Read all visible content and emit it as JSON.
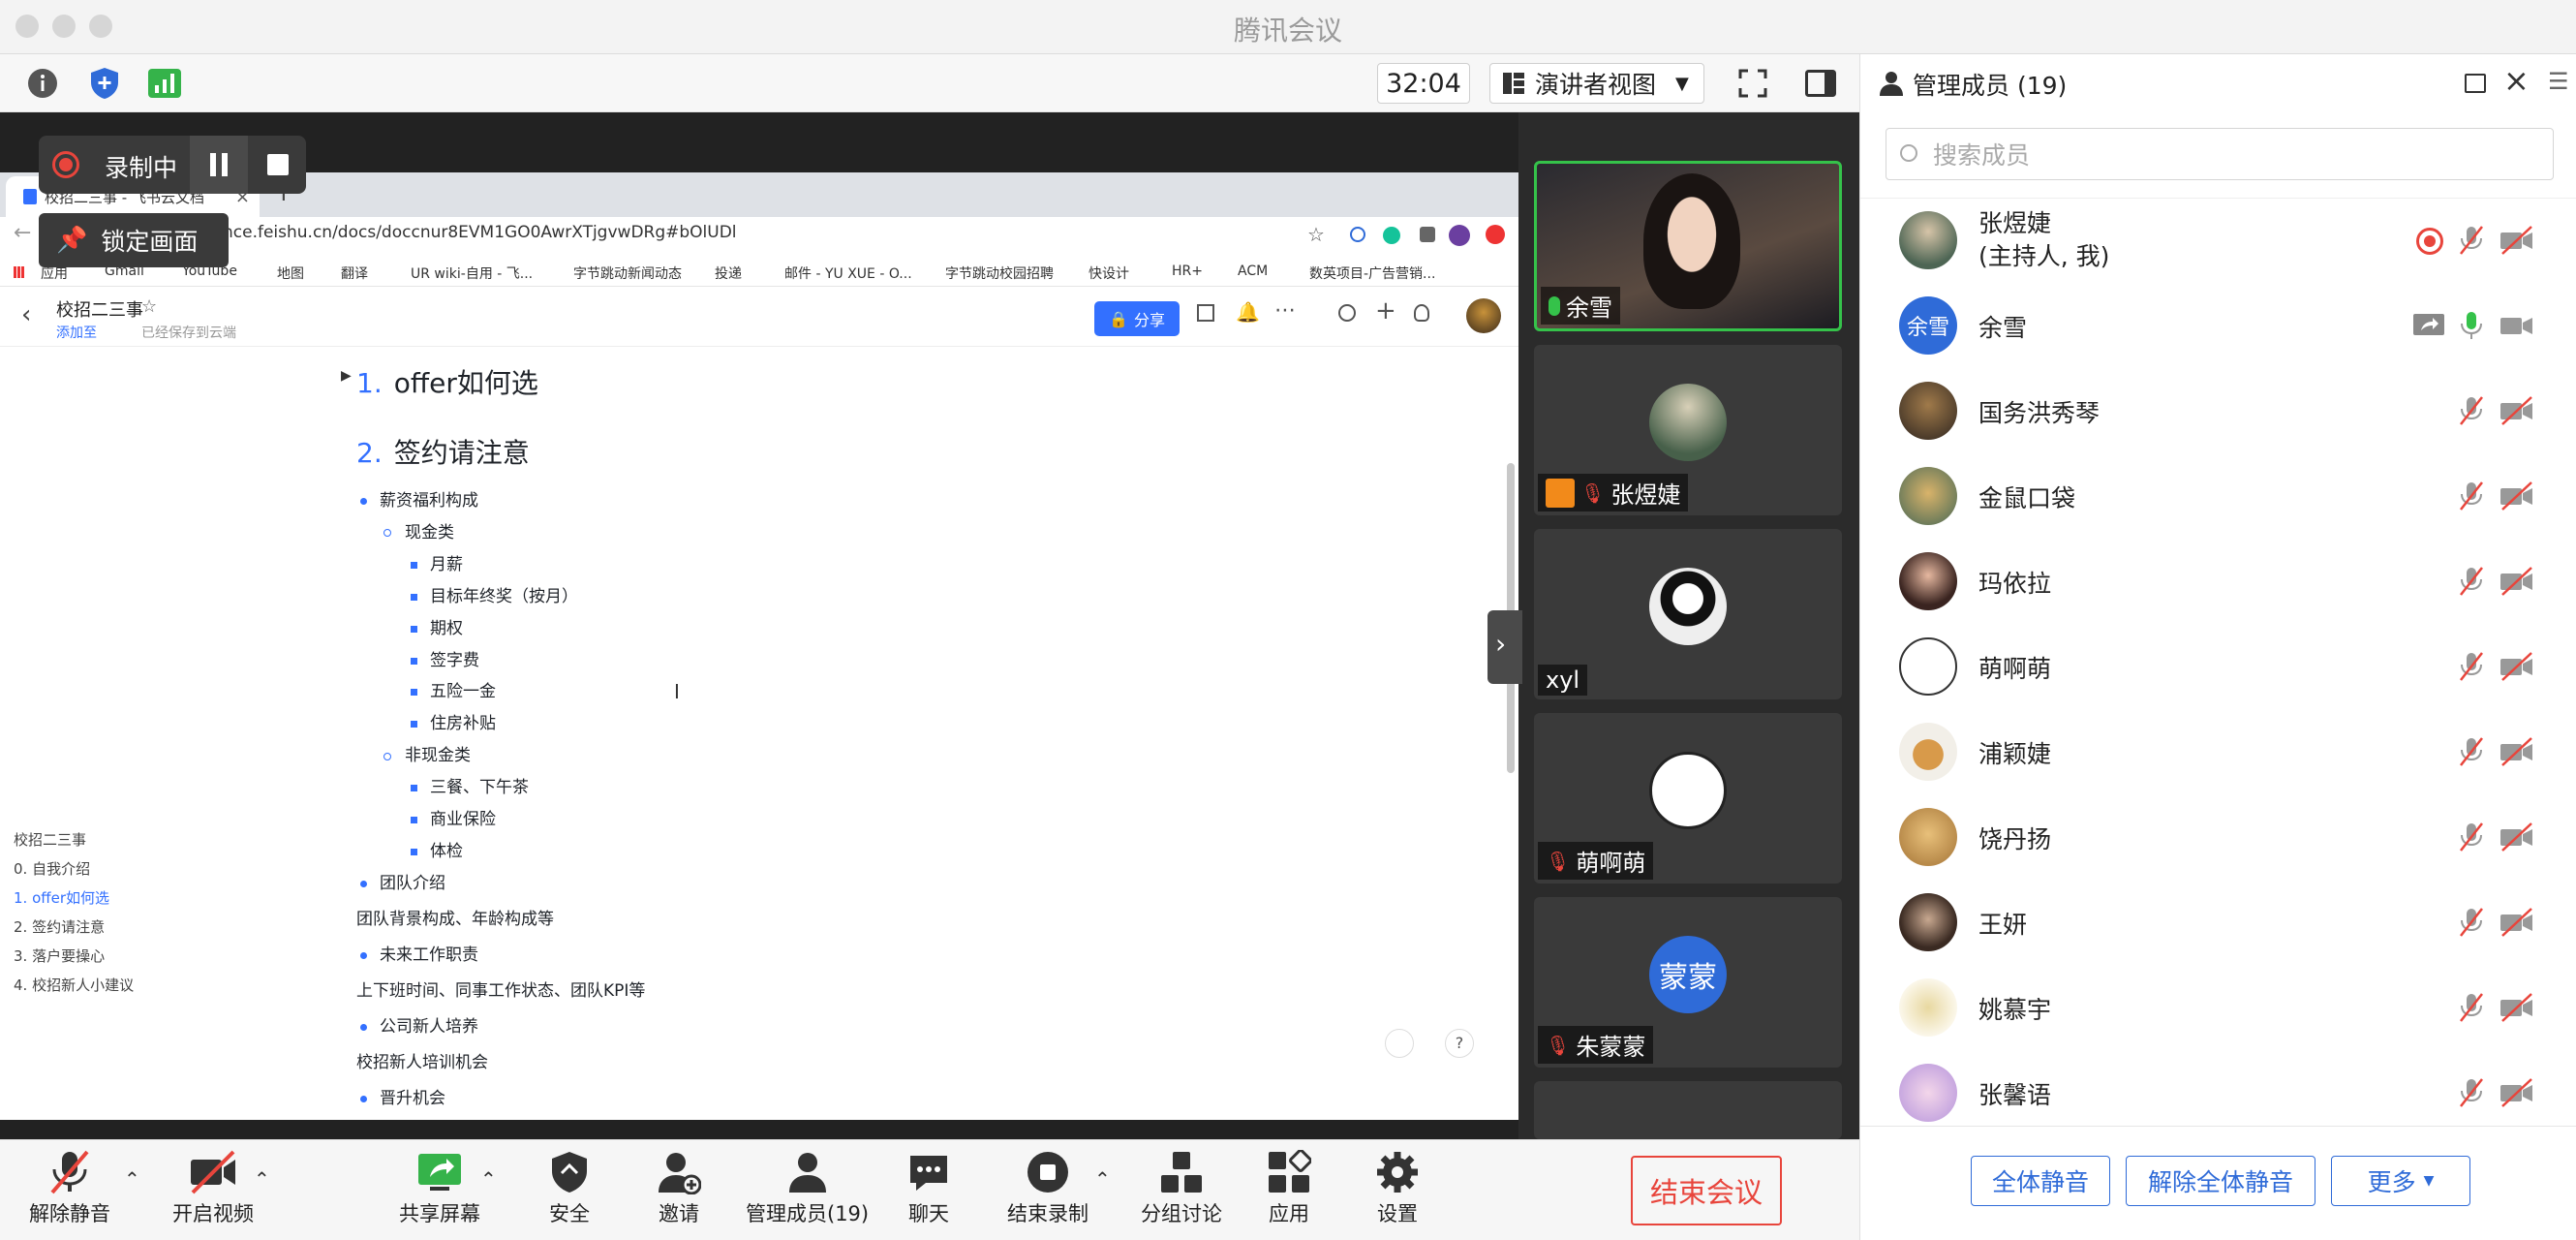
{
  "app_title": "腾讯会议",
  "meeting_toolbar": {
    "timer": "32:04",
    "view_mode": "演讲者视图"
  },
  "recording": {
    "status": "录制中",
    "pin_label": "锁定画面"
  },
  "browser": {
    "tab_title": "校招二三事 - 飞书云文档",
    "url_visible": "nce.feishu.cn/docs/doccnur8EVM1GO0AwrXTjgvwDRg#bOlUDl",
    "bookmarks": [
      "应用",
      "Gmail",
      "YouTube",
      "地图",
      "翻译",
      "UR wiki-自用 - 飞...",
      "字节跳动新闻动态",
      "投递",
      "邮件 - YU XUE - O...",
      "字节跳动校园招聘",
      "快设计",
      "HR+",
      "ACM",
      "数英项目-广告营销..."
    ]
  },
  "doc": {
    "title": "校招二三事",
    "add_to": "添加至",
    "saved": "已经保存到云端",
    "share_label": "分享",
    "toc": [
      "校招二三事",
      "0. 自我介绍",
      "1. offer如何选",
      "2. 签约请注意",
      "3. 落户要操心",
      "4. 校招新人小建议"
    ],
    "h1_num": "1.",
    "h1_text": "offer如何选",
    "h2_num": "2.",
    "h2_text": "签约请注意",
    "items": {
      "salary": "薪资福利构成",
      "cash": "现金类",
      "c1": "月薪",
      "c2": "目标年终奖（按月）",
      "c3": "期权",
      "c4": "签字费",
      "c5": "五险一金",
      "c6": "住房补贴",
      "noncash": "非现金类",
      "n1": "三餐、下午茶",
      "n2": "商业保险",
      "n3": "体检",
      "team": "团队介绍",
      "team_desc": "团队背景构成、年龄构成等",
      "future": "未来工作职责",
      "future_desc": "上下班时间、同事工作状态、团队KPI等",
      "training": "公司新人培养",
      "training_desc": "校招新人培训机会",
      "promo": "晋升机会"
    }
  },
  "video_tiles": [
    {
      "name": "余雪"
    },
    {
      "name": "张煜婕"
    },
    {
      "name": "xyl"
    },
    {
      "name": "萌啊萌"
    },
    {
      "name": "朱蒙蒙",
      "avatar_text": "蒙蒙"
    }
  ],
  "bottom_toolbar": {
    "unmute": "解除静音",
    "video": "开启视频",
    "share": "共享屏幕",
    "security": "安全",
    "invite": "邀请",
    "members": "管理成员(19)",
    "chat": "聊天",
    "end_record": "结束录制",
    "breakout": "分组讨论",
    "apps": "应用",
    "settings": "设置",
    "end_meeting": "结束会议"
  },
  "member_panel": {
    "title": "管理成员 (19)",
    "search_placeholder": "搜索成员",
    "members": [
      {
        "name": "张煜婕",
        "role": "(主持人, 我)"
      },
      {
        "name": "余雪",
        "avatar_text": "余雪"
      },
      {
        "name": "国务洪秀琴"
      },
      {
        "name": "金鼠口袋"
      },
      {
        "name": "玛依拉"
      },
      {
        "name": "萌啊萌"
      },
      {
        "name": "浦颖婕"
      },
      {
        "name": "饶丹扬"
      },
      {
        "name": "王妍"
      },
      {
        "name": "姚慕宇"
      },
      {
        "name": "张馨语"
      }
    ],
    "mute_all": "全体静音",
    "unmute_all": "解除全体静音",
    "more": "更多"
  }
}
